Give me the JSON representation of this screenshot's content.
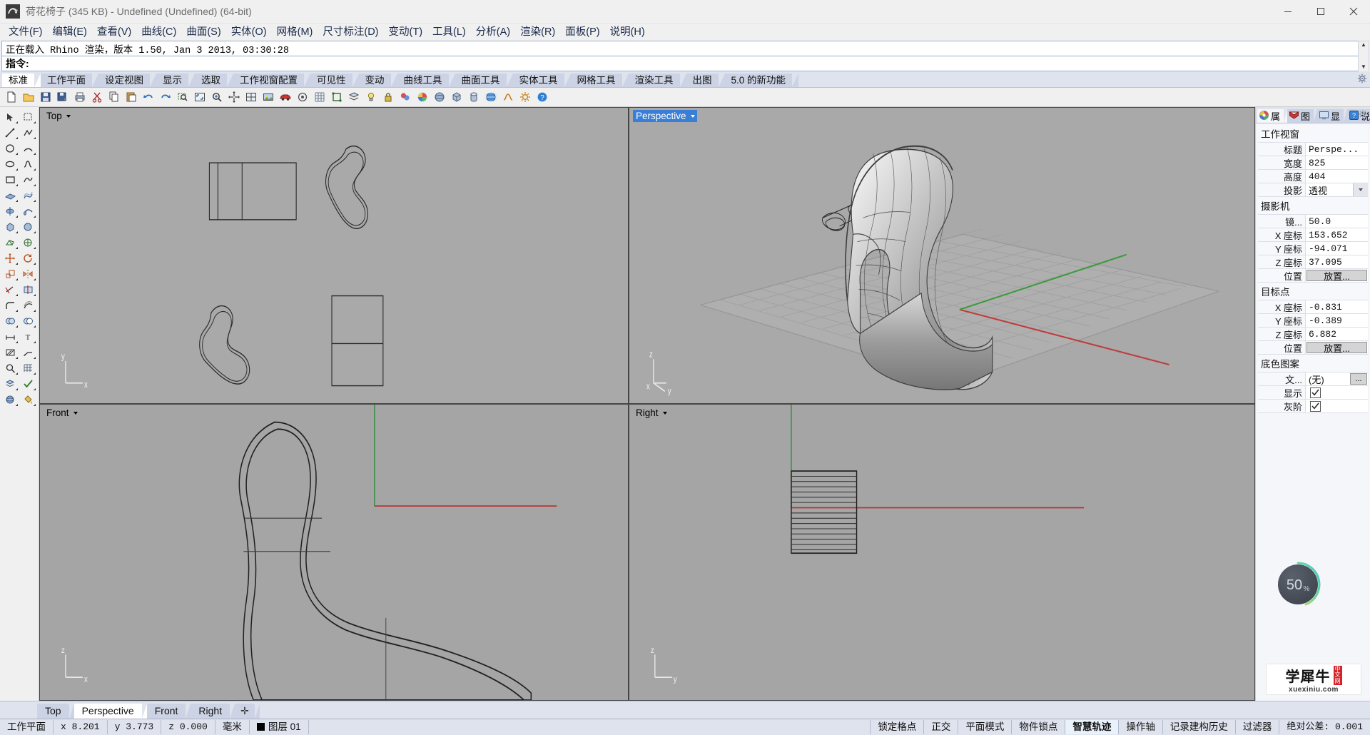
{
  "titlebar": {
    "doc_name": "荷花椅子",
    "doc_size": "(345 KB)",
    "rest": "- Undefined (Undefined) (64-bit)",
    "icon": "rhino-app-icon",
    "minimize": "minimize-icon",
    "maximize": "maximize-icon",
    "close": "close-icon"
  },
  "menu": [
    {
      "label": "文件(F)"
    },
    {
      "label": "编辑(E)"
    },
    {
      "label": "查看(V)"
    },
    {
      "label": "曲线(C)"
    },
    {
      "label": "曲面(S)"
    },
    {
      "label": "实体(O)"
    },
    {
      "label": "网格(M)"
    },
    {
      "label": "尺寸标注(D)"
    },
    {
      "label": "变动(T)"
    },
    {
      "label": "工具(L)"
    },
    {
      "label": "分析(A)"
    },
    {
      "label": "渲染(R)"
    },
    {
      "label": "面板(P)"
    },
    {
      "label": "说明(H)"
    }
  ],
  "command": {
    "history": "正在载入 Rhino 渲染，版本 1.50, Jan  3 2013, 03:30:28",
    "prompt": "指令:",
    "scroll_up": "▲",
    "scroll_down": "▼"
  },
  "toolbar_tabs": [
    {
      "label": "标准",
      "active": true
    },
    {
      "label": "工作平面",
      "active": false
    },
    {
      "label": "设定视图",
      "active": false
    },
    {
      "label": "显示",
      "active": false
    },
    {
      "label": "选取",
      "active": false
    },
    {
      "label": "工作视窗配置",
      "active": false
    },
    {
      "label": "可见性",
      "active": false
    },
    {
      "label": "变动",
      "active": false
    },
    {
      "label": "曲线工具",
      "active": false
    },
    {
      "label": "曲面工具",
      "active": false
    },
    {
      "label": "实体工具",
      "active": false
    },
    {
      "label": "网格工具",
      "active": false
    },
    {
      "label": "渲染工具",
      "active": false
    },
    {
      "label": "出图",
      "active": false
    },
    {
      "label": "5.0 的新功能",
      "active": false
    }
  ],
  "viewports": [
    {
      "name": "Top",
      "selected": false
    },
    {
      "name": "Perspective",
      "selected": true
    },
    {
      "name": "Front",
      "selected": false
    },
    {
      "name": "Right",
      "selected": false
    }
  ],
  "view_tabs": [
    {
      "label": "Top",
      "active": false
    },
    {
      "label": "Perspective",
      "active": true
    },
    {
      "label": "Front",
      "active": false
    },
    {
      "label": "Right",
      "active": false
    },
    {
      "label": "✛",
      "active": false
    }
  ],
  "statusbar": {
    "cplane": "工作平面",
    "x": "x 8.201",
    "y": "y 3.773",
    "z": "z 0.000",
    "units": "毫米",
    "layer": "图层 01",
    "layer_color": "#000000",
    "toggles": [
      {
        "label": "锁定格点",
        "on": false
      },
      {
        "label": "正交",
        "on": false
      },
      {
        "label": "平面模式",
        "on": false
      },
      {
        "label": "物件锁点",
        "on": false
      },
      {
        "label": "智慧轨迹",
        "on": true
      },
      {
        "label": "操作轴",
        "on": false
      },
      {
        "label": "记录建构历史",
        "on": false
      },
      {
        "label": "过滤器",
        "on": false
      }
    ],
    "tolerance": "绝对公差: 0.001"
  },
  "right_panel": {
    "tabs": [
      {
        "label": "属",
        "icon": "properties-icon",
        "active": true
      },
      {
        "label": "图",
        "icon": "layers-icon",
        "active": false
      },
      {
        "label": "显",
        "icon": "display-icon",
        "active": false
      },
      {
        "label": "说",
        "icon": "help-icon",
        "active": false
      }
    ],
    "gear": "gear-icon",
    "sections": [
      {
        "title": "工作视窗",
        "rows": [
          {
            "label": "标题",
            "value": "Perspe...",
            "kind": "text"
          },
          {
            "label": "宽度",
            "value": "825",
            "kind": "text"
          },
          {
            "label": "高度",
            "value": "404",
            "kind": "text"
          },
          {
            "label": "投影",
            "value": "透视",
            "kind": "dropdown"
          }
        ]
      },
      {
        "title": "摄影机",
        "rows": [
          {
            "label": "镜...",
            "value": "50.0",
            "kind": "text"
          },
          {
            "label": "X 座标",
            "value": "153.652",
            "kind": "text"
          },
          {
            "label": "Y 座标",
            "value": "-94.071",
            "kind": "text"
          },
          {
            "label": "Z 座标",
            "value": "37.095",
            "kind": "text"
          },
          {
            "label": "位置",
            "value": "放置...",
            "kind": "button"
          }
        ]
      },
      {
        "title": "目标点",
        "rows": [
          {
            "label": "X 座标",
            "value": "-0.831",
            "kind": "text"
          },
          {
            "label": "Y 座标",
            "value": "-0.389",
            "kind": "text"
          },
          {
            "label": "Z 座标",
            "value": "6.882",
            "kind": "text"
          },
          {
            "label": "位置",
            "value": "放置...",
            "kind": "button"
          }
        ]
      },
      {
        "title": "底色图案",
        "rows": [
          {
            "label": "文...",
            "value": "(无)",
            "kind": "browse"
          },
          {
            "label": "显示",
            "value": "",
            "kind": "checkbox",
            "checked": true
          },
          {
            "label": "灰阶",
            "value": "",
            "kind": "checkbox",
            "checked": true
          }
        ]
      }
    ],
    "progress": {
      "value": 50,
      "label": "50",
      "suffix": "%",
      "ring_color": "#8fd98f",
      "track_color": "#4c525c"
    },
    "watermark": {
      "cn": "学犀牛",
      "badge_line1": "中",
      "badge_line2": "文",
      "badge_line3": "网",
      "url": "xuexiniu.com"
    }
  }
}
